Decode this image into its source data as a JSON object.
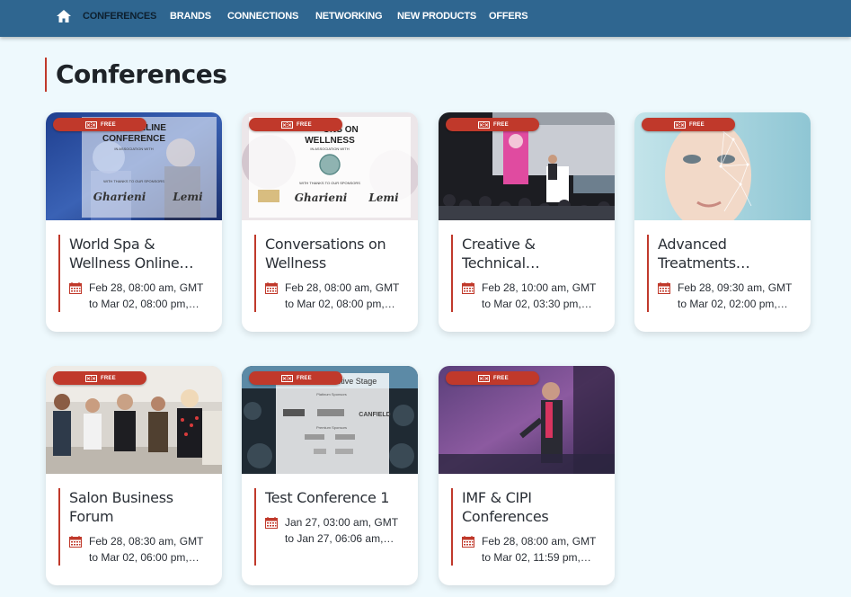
{
  "nav": {
    "items": [
      {
        "label": "CONFERENCES"
      },
      {
        "label": "BRANDS"
      },
      {
        "label": "CONNECTIONS"
      },
      {
        "label": "NETWORKING"
      },
      {
        "label": "NEW PRODUCTS"
      },
      {
        "label": "OFFERS"
      }
    ],
    "active_index": 0
  },
  "page": {
    "title": "Conferences"
  },
  "colors": {
    "nav_bg": "#2f6690",
    "accent": "#c0392b",
    "page_bg": "#eef9fd"
  },
  "cards": [
    {
      "badge": "FREE",
      "title": "World Spa & Wellness Online…",
      "date_line1": "Feb 28, 08:00 am, GMT",
      "date_line2": "to Mar 02, 08:00 pm,…",
      "thumb": {
        "line1": "ONLINE",
        "line2": "CONFERENCE",
        "line3": "IN ASSOCIATION WITH",
        "line4": "WITH THANKS TO OUR SPONSORS",
        "brand1": "Gharieni",
        "brand2": "Lemi"
      }
    },
    {
      "badge": "FREE",
      "title": "Conversations on Wellness",
      "date_line1": "Feb 28, 08:00 am, GMT",
      "date_line2": "to Mar 02, 08:00 pm,…",
      "thumb": {
        "line1": "ONS ON",
        "line2": "WELLNESS",
        "line3": "IN ASSOCIATION WITH",
        "line4": "WITH THANKS TO OUR SPONSORS",
        "brand1": "Gharieni",
        "brand2": "Lemi"
      }
    },
    {
      "badge": "FREE",
      "title": "Creative & Technical…",
      "date_line1": "Feb 28, 10:00 am, GMT",
      "date_line2": "to Mar 02, 03:30 pm,…"
    },
    {
      "badge": "FREE",
      "title": "Advanced Treatments…",
      "date_line1": "Feb 28, 09:30 am, GMT",
      "date_line2": "to Mar 02, 02:00 pm,…"
    },
    {
      "badge": "FREE",
      "title": "Salon Business Forum",
      "date_line1": "Feb 28, 08:30 am, GMT",
      "date_line2": "to Mar 02, 06:00 pm,…"
    },
    {
      "badge": "FREE",
      "title": "Test Conference 1",
      "date_line1": "Jan 27, 03:00 am, GMT",
      "date_line2": "to Jan 27, 06:06 am,…",
      "thumb": {
        "line1": "ctive Stage",
        "line2": "Platinum Sponsors",
        "line3": "CANFIELD",
        "line4": "Premium Sponsors"
      }
    },
    {
      "badge": "FREE",
      "title": "IMF & CIPI Conferences",
      "date_line1": "Feb 28, 08:00 am, GMT",
      "date_line2": "to Mar 02, 11:59 pm,…"
    }
  ]
}
